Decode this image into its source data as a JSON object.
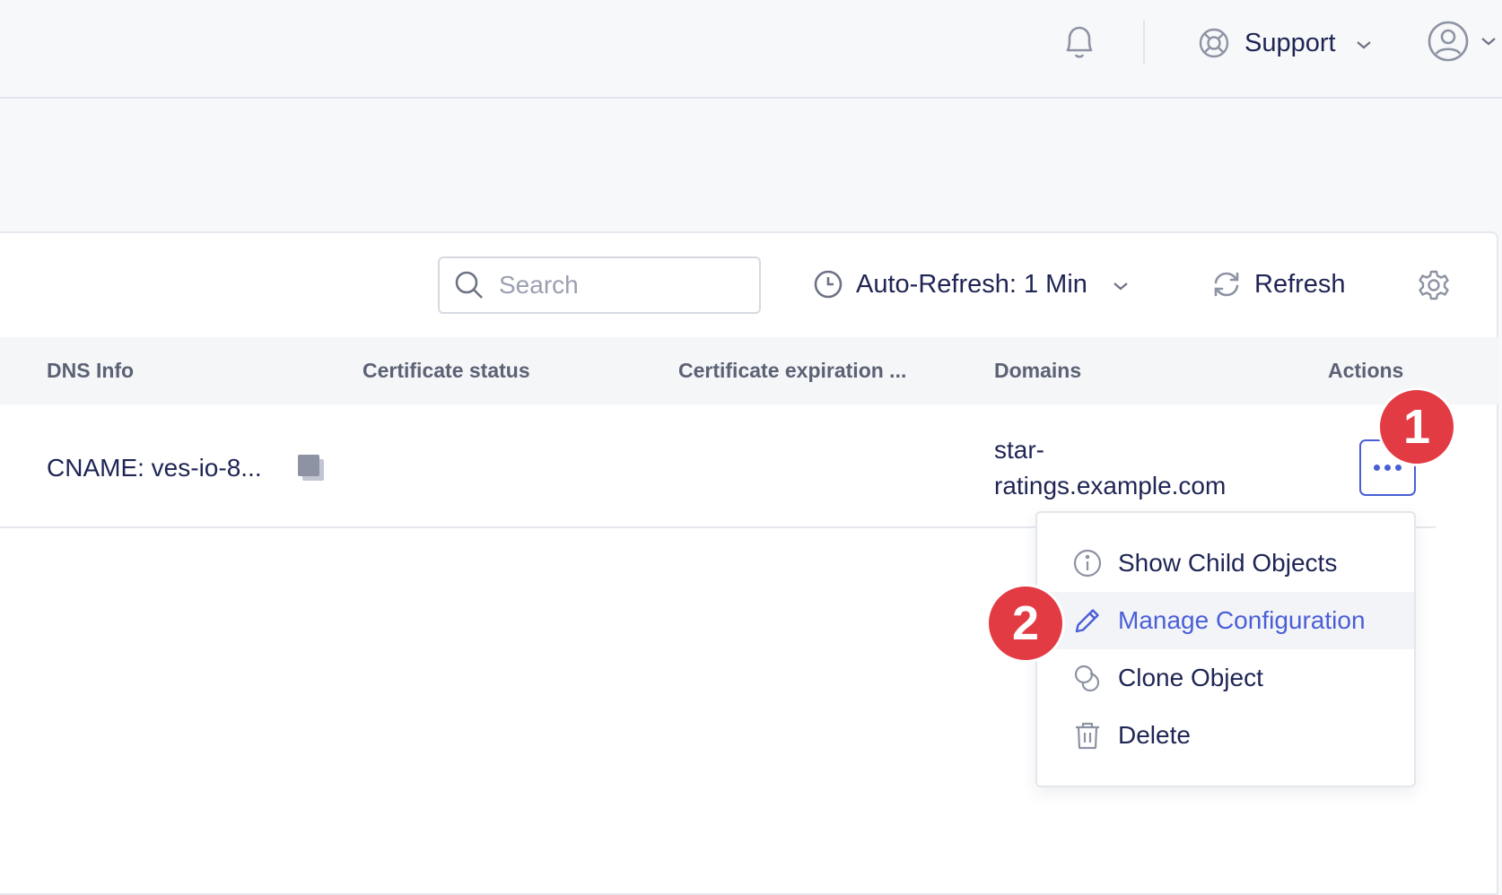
{
  "header": {
    "support_label": "Support"
  },
  "toolbar": {
    "search_placeholder": "Search",
    "auto_refresh_label": "Auto-Refresh: 1 Min",
    "refresh_label": "Refresh"
  },
  "table": {
    "columns": [
      "DNS Info",
      "Certificate status",
      "Certificate expiration ...",
      "Domains",
      "Actions"
    ],
    "rows": [
      {
        "dns_info": "CNAME: ves-io-8...",
        "certificate_status": "",
        "certificate_expiration": "",
        "domains_line1": "star-",
        "domains_line2": "ratings.example.com"
      }
    ]
  },
  "actions_menu": {
    "items": [
      {
        "label": "Show Child Objects",
        "icon": "info-icon"
      },
      {
        "label": "Manage Configuration",
        "icon": "pencil-icon",
        "active": true
      },
      {
        "label": "Clone Object",
        "icon": "clone-icon"
      },
      {
        "label": "Delete",
        "icon": "trash-icon"
      }
    ]
  },
  "annotations": {
    "step1": "1",
    "step2": "2"
  },
  "colors": {
    "accent": "#4a5fd6",
    "badge": "#e33b44",
    "text": "#1f2554"
  }
}
